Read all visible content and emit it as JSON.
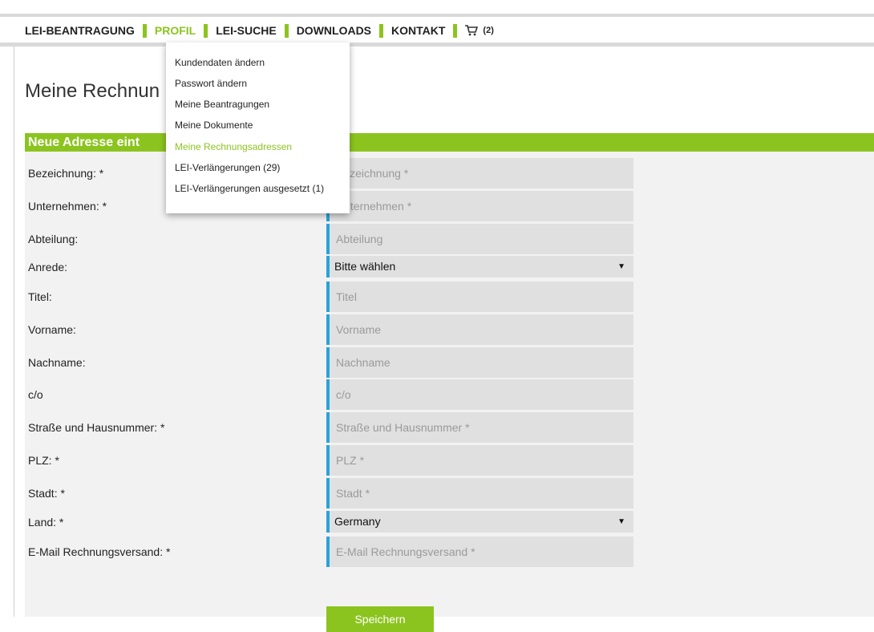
{
  "nav": {
    "items": [
      "LEI-BEANTRAGUNG",
      "PROFIL",
      "LEI-SUCHE",
      "DOWNLOADS",
      "KONTAKT"
    ],
    "active": "PROFIL",
    "cart_count": "(2)",
    "cart_icon": "shopping-cart-icon"
  },
  "dropdown": {
    "items": [
      "Kundendaten ändern",
      "Passwort ändern",
      "Meine Beantragungen",
      "Meine Dokumente",
      "Meine Rechnungsadressen",
      "LEI-Verlängerungen (29)",
      "LEI-Verlängerungen ausgesetzt (1)"
    ],
    "active": "Meine Rechnungsadressen"
  },
  "page": {
    "title_visible": "Meine Rechnun"
  },
  "form": {
    "header_visible": "Neue Adresse eint",
    "fields": [
      {
        "label": "Bezeichnung: *",
        "placeholder": "Bezeichnung *"
      },
      {
        "label": "Unternehmen: *",
        "placeholder": "Unternehmen *"
      },
      {
        "label": "Abteilung:",
        "placeholder": "Abteilung"
      },
      {
        "label": "Anrede:",
        "value": "Bitte wählen"
      },
      {
        "label": "Titel:",
        "placeholder": "Titel"
      },
      {
        "label": "Vorname:",
        "placeholder": "Vorname"
      },
      {
        "label": "Nachname:",
        "placeholder": "Nachname"
      },
      {
        "label": "c/o",
        "placeholder": "c/o"
      },
      {
        "label": "Straße und Hausnummer: *",
        "placeholder": "Straße und Hausnummer *"
      },
      {
        "label": "PLZ: *",
        "placeholder": "PLZ *"
      },
      {
        "label": "Stadt: *",
        "placeholder": "Stadt *"
      },
      {
        "label": "Land: *",
        "value": "Germany"
      },
      {
        "label": "E-Mail Rechnungsversand: *",
        "placeholder": "E-Mail Rechnungsversand *"
      }
    ],
    "save_label": "Speichern"
  },
  "colors": {
    "accent_green": "#8cc41f",
    "input_border_blue": "#29a3d8",
    "input_bg": "#e0e0e0"
  }
}
